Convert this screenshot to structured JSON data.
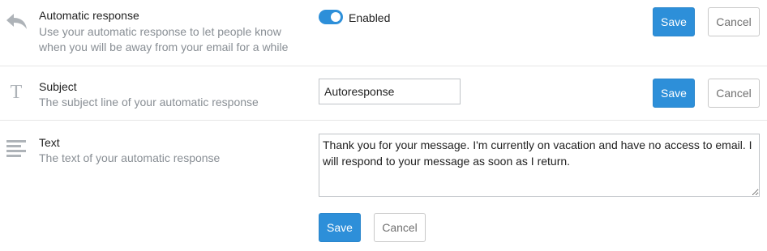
{
  "auto_response": {
    "title": "Automatic response",
    "description": "Use your automatic response to let people know when you will be away from your email for a while",
    "toggle_label": "Enabled",
    "enabled": true,
    "save_label": "Save",
    "cancel_label": "Cancel",
    "icon": "reply-icon"
  },
  "subject": {
    "title": "Subject",
    "description": "The subject line of your automatic response",
    "value": "Autoresponse",
    "save_label": "Save",
    "cancel_label": "Cancel",
    "icon": "text-type-icon"
  },
  "text": {
    "title": "Text",
    "description": "The text of your automatic response",
    "value": "Thank you for your message. I'm currently on vacation and have no access to email. I will respond to your message as soon as I return.",
    "save_label": "Save",
    "cancel_label": "Cancel",
    "icon": "paragraph-lines-icon"
  },
  "colors": {
    "accent": "#2d8fd9",
    "muted_text": "#888e94",
    "icon": "#aeb3b8"
  }
}
